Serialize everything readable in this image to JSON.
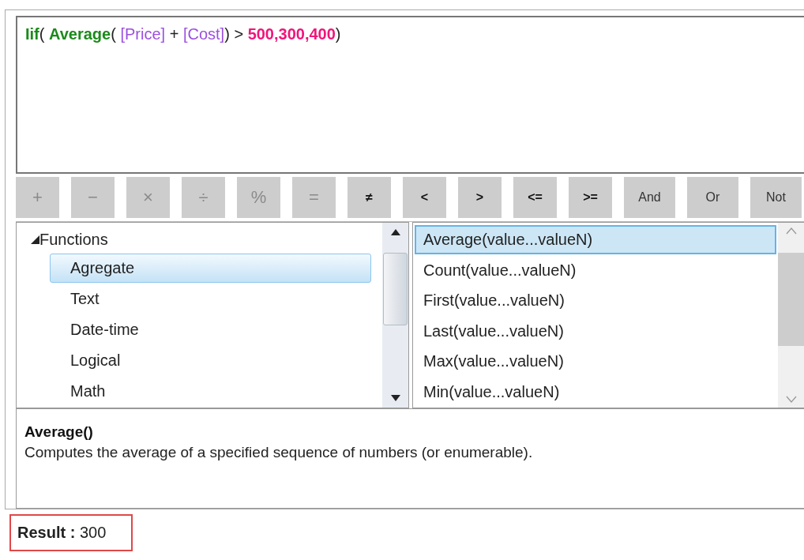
{
  "formula_editor": {
    "tokens": [
      {
        "kind": "function",
        "text": "Iif"
      },
      {
        "kind": "paren",
        "text": "( "
      },
      {
        "kind": "function",
        "text": "Average"
      },
      {
        "kind": "paren",
        "text": "( "
      },
      {
        "kind": "field",
        "text": "[Price]"
      },
      {
        "kind": "operator",
        "text": " + "
      },
      {
        "kind": "field",
        "text": "[Cost]"
      },
      {
        "kind": "paren",
        "text": ")"
      },
      {
        "kind": "operator",
        "text": " > "
      },
      {
        "kind": "number",
        "text": "500,300,400"
      },
      {
        "kind": "paren",
        "text": ")"
      }
    ]
  },
  "operators": [
    {
      "label": "+",
      "disabled": true
    },
    {
      "label": "−",
      "disabled": true
    },
    {
      "label": "×",
      "disabled": true
    },
    {
      "label": "÷",
      "disabled": true
    },
    {
      "label": "%",
      "disabled": true
    },
    {
      "label": "=",
      "disabled": true
    },
    {
      "label": "≠",
      "disabled": false
    },
    {
      "label": "<",
      "disabled": false
    },
    {
      "label": ">",
      "disabled": false
    },
    {
      "label": "<=",
      "disabled": false
    },
    {
      "label": ">=",
      "disabled": false
    },
    {
      "label": "And",
      "disabled": false,
      "kind": "word"
    },
    {
      "label": "Or",
      "disabled": false,
      "kind": "word"
    },
    {
      "label": "Not",
      "disabled": false,
      "kind": "word"
    }
  ],
  "category_tree": {
    "label": "Functions",
    "expanded": true,
    "children": [
      {
        "label": "Agregate",
        "selected": true
      },
      {
        "label": "Text",
        "selected": false
      },
      {
        "label": "Date-time",
        "selected": false
      },
      {
        "label": "Logical",
        "selected": false
      },
      {
        "label": "Math",
        "selected": false
      }
    ]
  },
  "function_list": [
    {
      "label": "Average(value...valueN)",
      "selected": true
    },
    {
      "label": "Count(value...valueN)",
      "selected": false
    },
    {
      "label": "First(value...valueN)",
      "selected": false
    },
    {
      "label": "Last(value...valueN)",
      "selected": false
    },
    {
      "label": "Max(value...valueN)",
      "selected": false
    },
    {
      "label": "Min(value...valueN)",
      "selected": false
    }
  ],
  "description": {
    "title": "Average()",
    "text": "Computes the average of a specified sequence of numbers (or enumerable)."
  },
  "result": "**Result :** 300"
}
